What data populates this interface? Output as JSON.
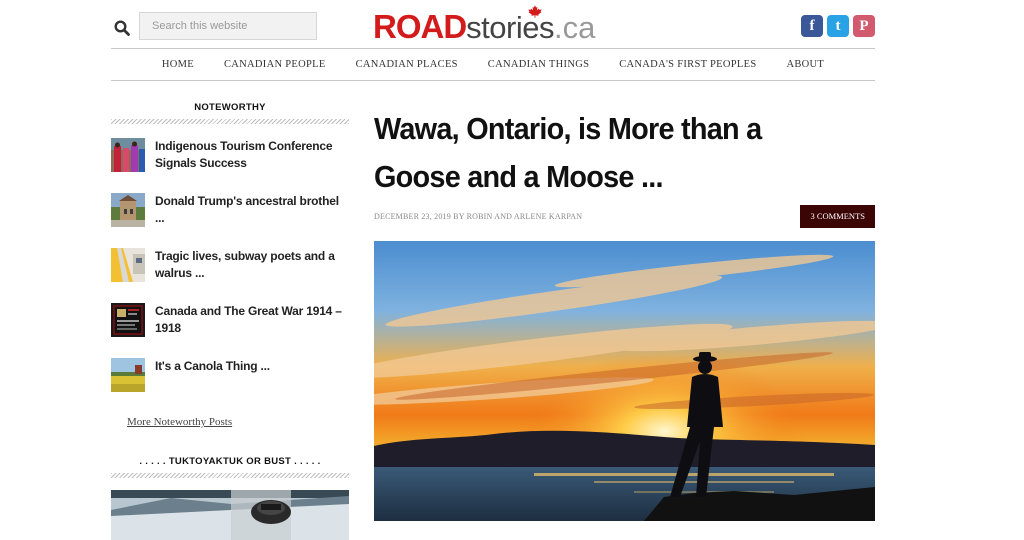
{
  "header": {
    "search": {
      "placeholder": "Search this website"
    },
    "logo": {
      "road": "ROAD",
      "stories": "stories",
      "tld": ".ca"
    },
    "social": [
      {
        "name": "facebook",
        "glyph": "f",
        "color": "#3b5998"
      },
      {
        "name": "twitter",
        "glyph": "t",
        "color": "#2aa3e6"
      },
      {
        "name": "pinterest",
        "glyph": "P",
        "color": "#d25a6e"
      }
    ]
  },
  "nav": {
    "items": [
      "HOME",
      "CANADIAN PEOPLE",
      "CANADIAN PLACES",
      "CANADIAN THINGS",
      "CANADA'S FIRST PEOPLES",
      "ABOUT"
    ]
  },
  "sidebar": {
    "noteworthy_title": "NOTEWORTHY",
    "posts": [
      {
        "title": "Indigenous Tourism Conference Signals Success"
      },
      {
        "title": "Donald Trump's ancestral brothel ..."
      },
      {
        "title": "Tragic lives, subway poets and a walrus ..."
      },
      {
        "title": "Canada and The Great War 1914 – 1918"
      },
      {
        "title": "It's a Canola Thing ..."
      }
    ],
    "more_link": "More Noteworthy Posts",
    "tuk_title": ". . . . . TUKTOYAKTUK OR BUST . . . . ."
  },
  "article": {
    "title": "Wawa, Ontario, is More than a Goose and a Moose ...",
    "meta": "DECEMBER 23, 2019 BY ROBIN AND ARLENE KARPAN",
    "comments": "3 COMMENTS"
  },
  "colors": {
    "brand_red": "#d31b1b",
    "comments_bg": "#3c0505"
  }
}
